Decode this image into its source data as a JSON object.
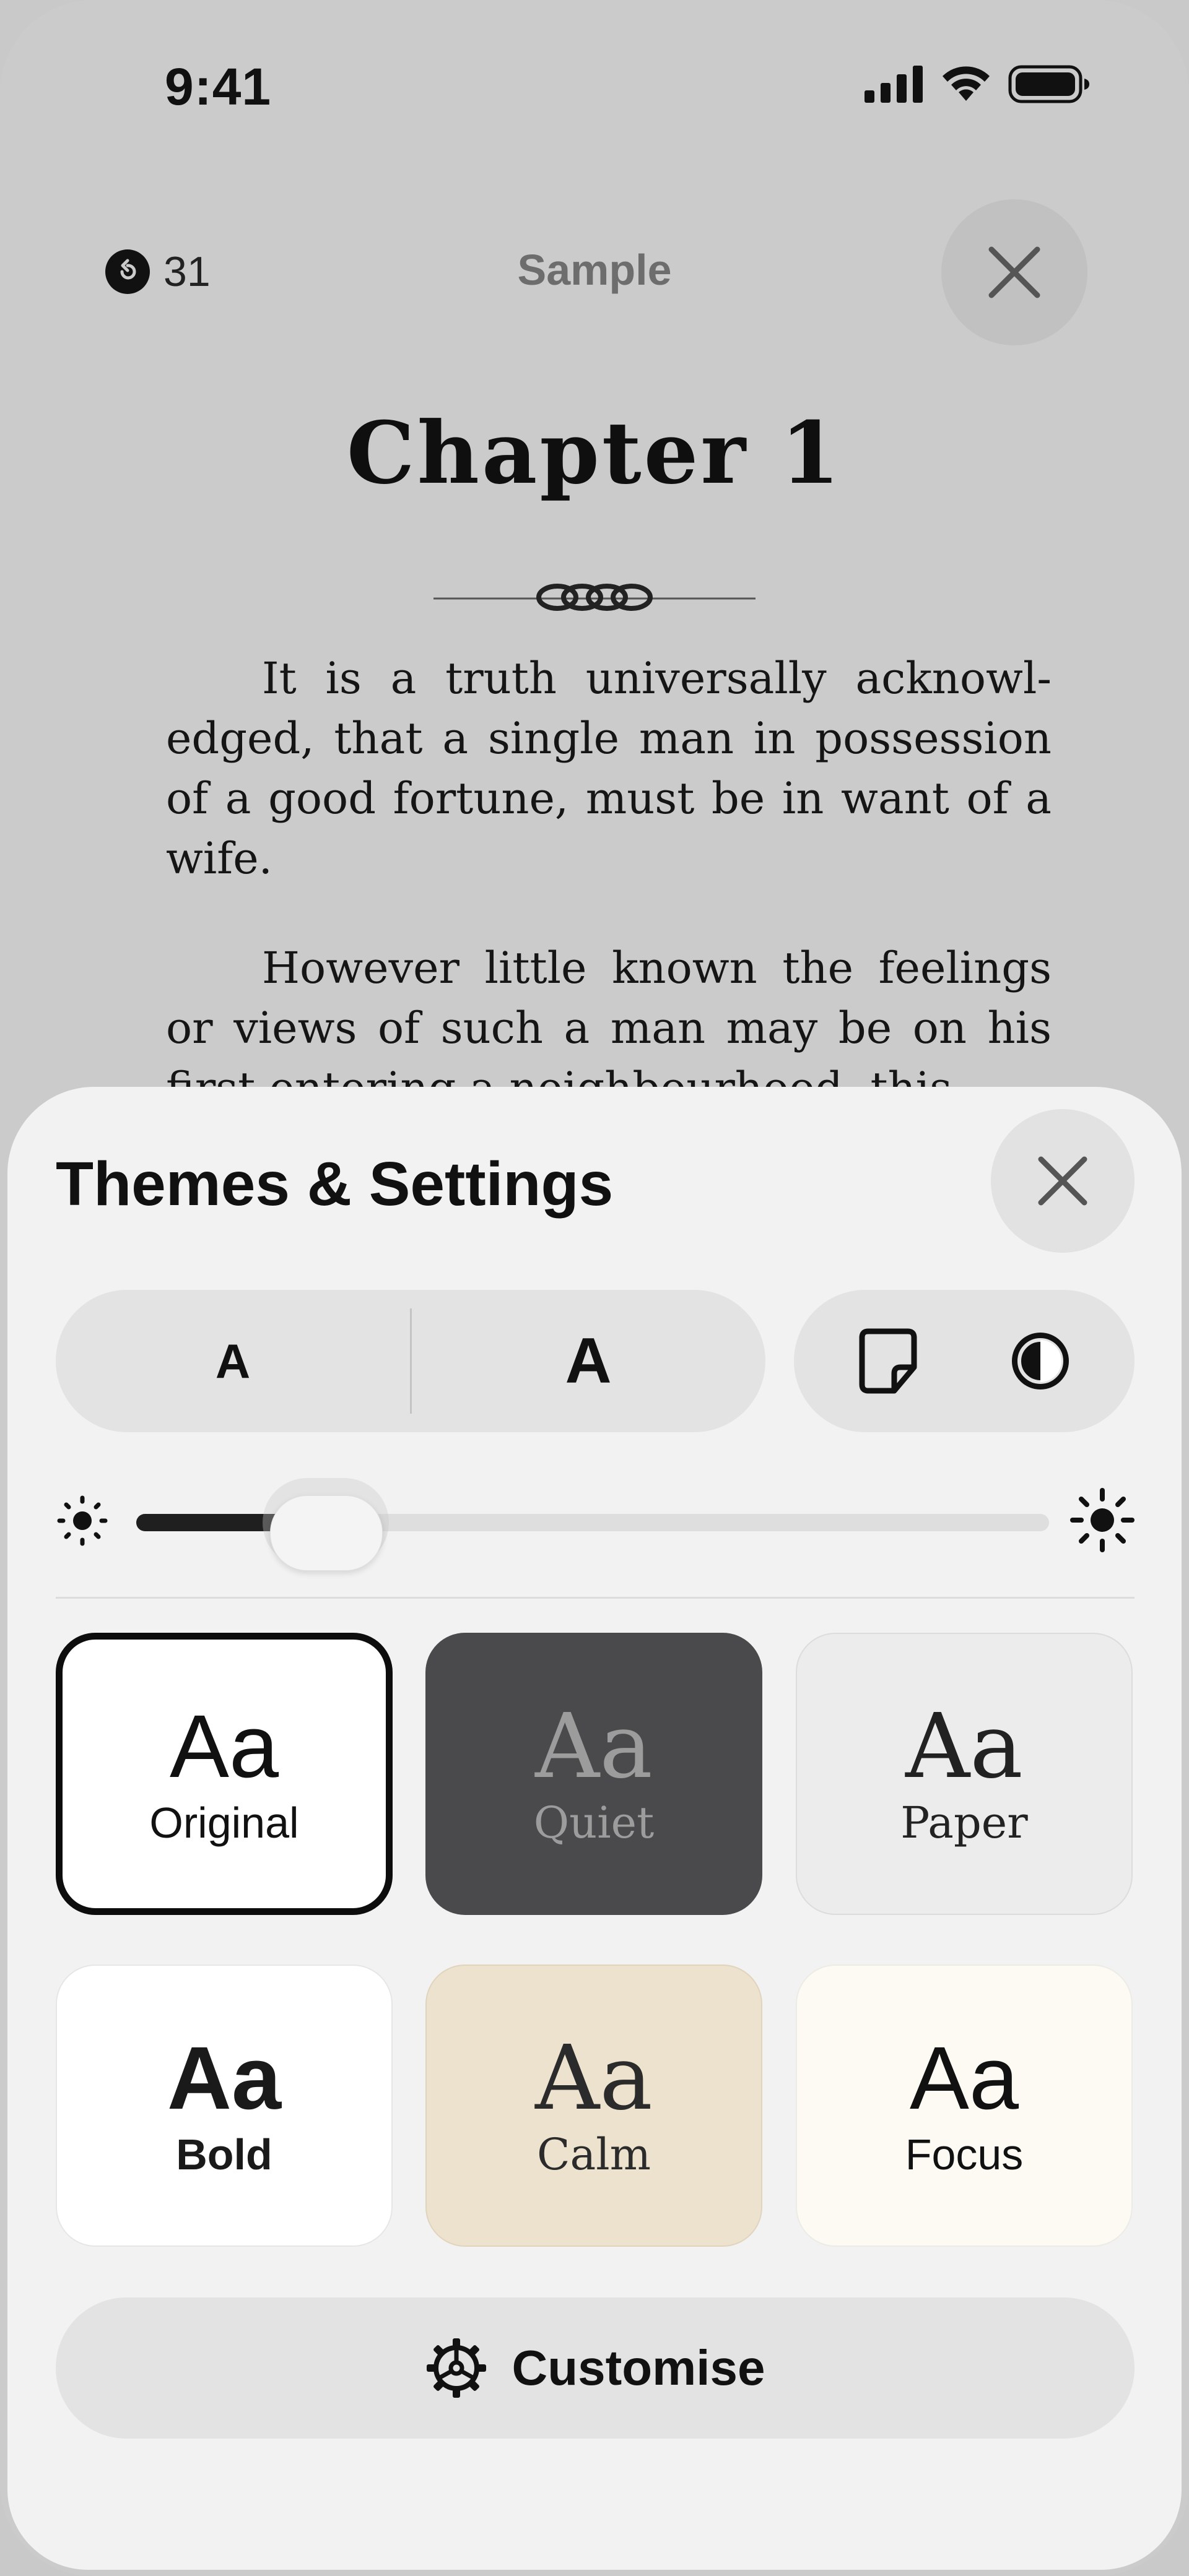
{
  "status_bar": {
    "time": "9:41",
    "icons": [
      "cellular-signal-icon",
      "wifi-icon",
      "battery-icon"
    ]
  },
  "reader": {
    "progress_count": "31",
    "book_title": "Sample",
    "chapter_title": "Chapter 1",
    "paragraphs": [
      "It is a truth universally acknowl­edged, that a single man in possession of a good fortune, must be in want of a wife.",
      "However little known the feelings or views of such a man may be on his first entering a neighbourhood, this"
    ]
  },
  "settings": {
    "title": "Themes & Settings",
    "font_size_small_label": "A",
    "font_size_large_label": "A",
    "mode_icons": [
      "page-view-icon",
      "appearance-contrast-icon"
    ],
    "brightness": 0.14,
    "themes": [
      {
        "name": "Original",
        "sample": "Aa",
        "selected": true,
        "background": "#ffffff"
      },
      {
        "name": "Quiet",
        "sample": "Aa",
        "selected": false,
        "background": "#4a4a4c"
      },
      {
        "name": "Paper",
        "sample": "Aa",
        "selected": false,
        "background": "#ececec"
      },
      {
        "name": "Bold",
        "sample": "Aa",
        "selected": false,
        "background": "#ffffff"
      },
      {
        "name": "Calm",
        "sample": "Aa",
        "selected": false,
        "background": "#ede2cd"
      },
      {
        "name": "Focus",
        "sample": "Aa",
        "selected": false,
        "background": "#fcfaf3"
      }
    ],
    "customise_label": "Customise"
  }
}
